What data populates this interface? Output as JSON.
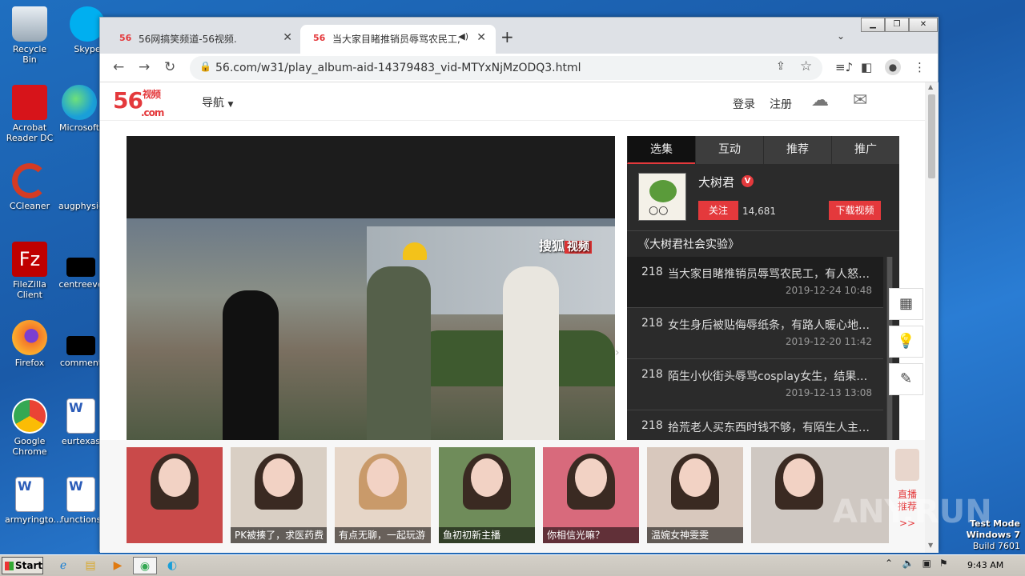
{
  "desktop": {
    "icons": [
      {
        "label": "Recycle Bin",
        "icon": "recycle-bin-icon",
        "color": "#c9d4df"
      },
      {
        "label": "Skype",
        "icon": "skype-icon",
        "color": "#00aff0"
      },
      {
        "label": "Acrobat Reader DC",
        "icon": "acrobat-icon",
        "color": "#d7141a"
      },
      {
        "label": "Microsoft",
        "icon": "edge-icon",
        "color": "#1a9fd8"
      },
      {
        "label": "CCleaner",
        "icon": "ccleaner-icon",
        "color": "#d43b23"
      },
      {
        "label": "augphysic",
        "icon": "file-icon",
        "color": "#1f6fc0"
      },
      {
        "label": "FileZilla Client",
        "icon": "filezilla-icon",
        "color": "#bf0000"
      },
      {
        "label": "centreeve",
        "icon": "file-icon",
        "color": "#000000"
      },
      {
        "label": "Firefox",
        "icon": "firefox-icon",
        "color": "#f3772a"
      },
      {
        "label": "comment",
        "icon": "file-icon",
        "color": "#000000"
      },
      {
        "label": "Google Chrome",
        "icon": "chrome-icon",
        "color": "#34a853"
      },
      {
        "label": "eurtexas",
        "icon": "word-doc-icon",
        "color": "#2b5cb8"
      },
      {
        "label": "armyringto...",
        "icon": "word-doc-icon",
        "color": "#2b5cb8"
      },
      {
        "label": "functions",
        "icon": "word-doc-icon",
        "color": "#2b5cb8"
      }
    ]
  },
  "browser": {
    "tabs": [
      {
        "favicon": "56",
        "title": "56网搞笑频道-56视频.",
        "active": false
      },
      {
        "favicon": "56",
        "title": "当大家目睹推销员辱骂农民工,",
        "active": true
      }
    ],
    "url": "56.com/w31/play_album-aid-14379483_vid-MTYxNjMzODQ3.html"
  },
  "site": {
    "logo_main": "56",
    "logo_sub": "视频",
    "logo_dot": ".com",
    "nav_label": "导航",
    "login": "登录",
    "register": "注册",
    "watermark_left": "搜狐",
    "watermark_right": "视频"
  },
  "panel": {
    "tabs": [
      "选集",
      "互动",
      "推荐",
      "推广"
    ],
    "author": "大树君",
    "verified": "V",
    "follow": "关注",
    "fans": "14,681",
    "download": "下载视频",
    "album": "《大树君社会实验》",
    "episodes": [
      {
        "num": "218",
        "title": "当大家目睹推销员辱骂农民工，有人怒…",
        "date": "2019-12-24 10:48",
        "current": true
      },
      {
        "num": "218",
        "title": "女生身后被贴侮辱纸条，有路人暖心地…",
        "date": "2019-12-20 11:42",
        "current": false
      },
      {
        "num": "218",
        "title": "陌生小伙街头辱骂cosplay女生，结果反…",
        "date": "2019-12-13 13:08",
        "current": false
      },
      {
        "num": "218",
        "title": "拾荒老人买东西时钱不够，有陌生人主…",
        "date": "",
        "current": false
      }
    ]
  },
  "strip": {
    "thumbs": [
      {
        "caption": "",
        "bg": "#c94a4a"
      },
      {
        "caption": "PK被揍了，求医药费",
        "bg": "#d9cfc4"
      },
      {
        "caption": "有点无聊，一起玩游",
        "bg": "#e6d6c8"
      },
      {
        "caption": "鱼初初新主播",
        "bg": "#6f8c5a"
      },
      {
        "caption": "你相信光嘛？",
        "bg": "#d86a7c"
      },
      {
        "caption": "温婉女神雯雯",
        "bg": "#d8c8bd"
      },
      {
        "caption": "",
        "bg": "#cfc8c2"
      }
    ],
    "live_label": "直播推荐",
    "live_more": ">>"
  },
  "taskbar": {
    "start": "Start",
    "clock": "9:43 AM"
  },
  "overlay": {
    "test_mode": "Test Mode",
    "windows": "Windows 7",
    "build": "Build 7601",
    "anyrun": "ANY.RUN"
  }
}
